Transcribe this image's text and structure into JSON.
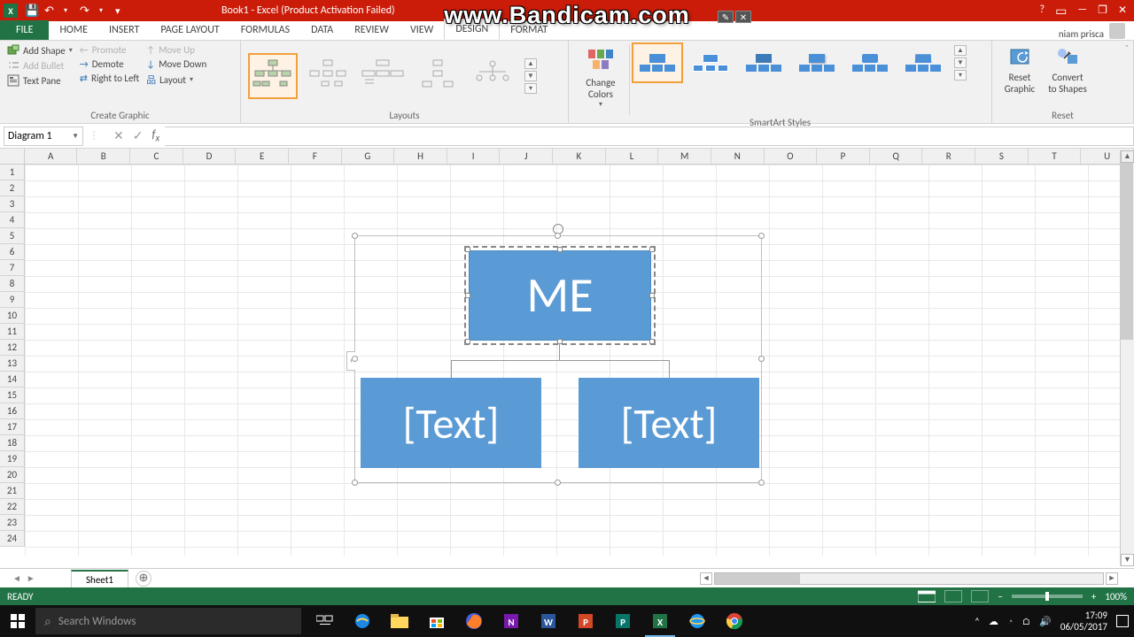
{
  "titlebar": {
    "app_initial": "X",
    "title": "Book1 -  Excel (Product Activation Failed)"
  },
  "watermark": "www.Bandicam.com",
  "tabs": {
    "file": "FILE",
    "items": [
      "HOME",
      "INSERT",
      "PAGE LAYOUT",
      "FORMULAS",
      "DATA",
      "REVIEW",
      "VIEW",
      "DESIGN",
      "FORMAT"
    ]
  },
  "username": "niam prisca",
  "ribbon": {
    "create_graphic": {
      "label": "Create Graphic",
      "add_shape": "Add Shape",
      "add_bullet": "Add Bullet",
      "text_pane": "Text Pane",
      "promote": "Promote",
      "demote": "Demote",
      "rtl": "Right to Left",
      "move_up": "Move Up",
      "move_down": "Move Down",
      "layout": "Layout"
    },
    "layouts": {
      "label": "Layouts"
    },
    "change_colors": "Change Colors",
    "styles": {
      "label": "SmartArt Styles"
    },
    "reset": {
      "label": "Reset",
      "reset_graphic": "Reset Graphic",
      "convert": "Convert to Shapes"
    }
  },
  "namebox": "Diagram 1",
  "columns": [
    "A",
    "B",
    "C",
    "D",
    "E",
    "F",
    "G",
    "H",
    "I",
    "J",
    "K",
    "L",
    "M",
    "N",
    "O",
    "P",
    "Q",
    "R",
    "S",
    "T",
    "U"
  ],
  "row_count": 24,
  "smartart": {
    "node_top": "ME",
    "node_bl": "[Text]",
    "node_br": "[Text]"
  },
  "sheet": {
    "name": "Sheet1"
  },
  "status": {
    "ready": "READY",
    "zoom": "100%"
  },
  "taskbar": {
    "search_placeholder": "Search Windows",
    "time": "17:09",
    "date": "06/05/2017"
  }
}
